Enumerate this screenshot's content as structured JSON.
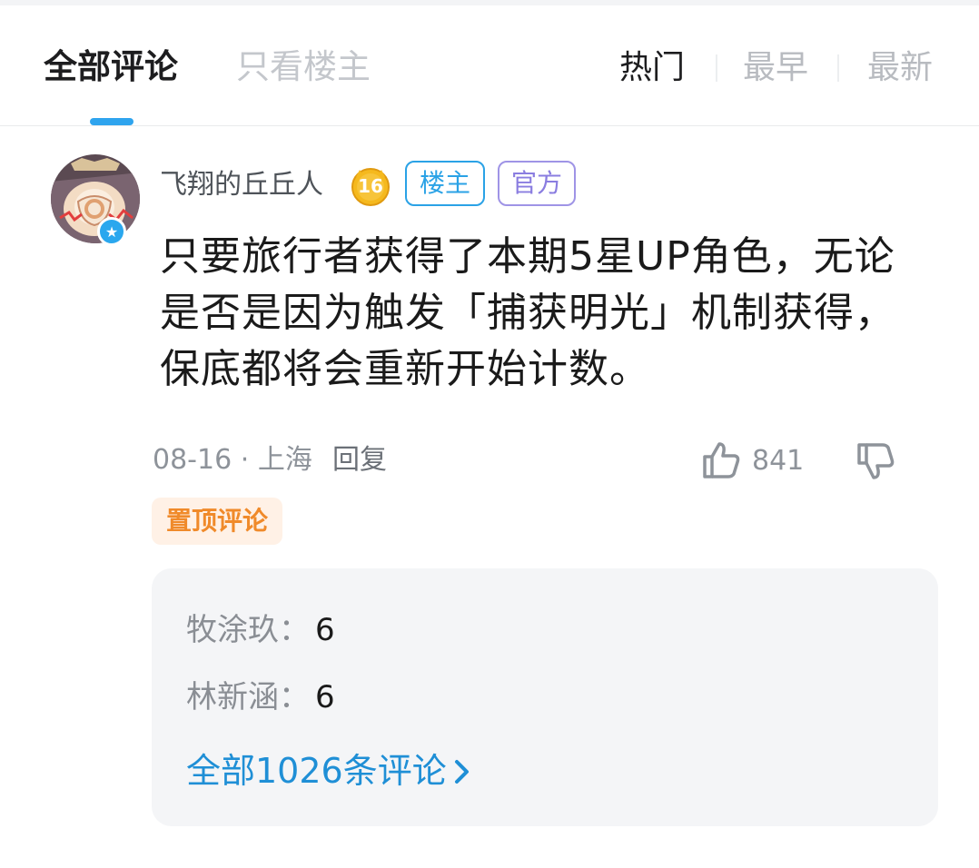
{
  "tabs": {
    "all": "全部评论",
    "op_only": "只看楼主"
  },
  "sort": {
    "hot": "热门",
    "earliest": "最早",
    "latest": "最新"
  },
  "comment": {
    "username": "飞翔的丘丘人",
    "level": "16",
    "tag_op": "楼主",
    "tag_official": "官方",
    "text": "只要旅行者获得了本期5星UP角色，无论是否是因为触发「捕获明光」机制获得，保底都将会重新开始计数。",
    "date": "08-16",
    "separator": "·",
    "location": "上海",
    "reply_label": "回复",
    "like_count": "841",
    "pinned_label": "置顶评论"
  },
  "replies": [
    {
      "name": "牧涂玖：",
      "text": "6"
    },
    {
      "name": "林新涵：",
      "text": "6"
    }
  ],
  "all_replies_link": "全部1026条评论",
  "colors": {
    "accent": "#2fa4ee",
    "op_tag": "#2aa2e6",
    "official_tag": "#8a7de0",
    "pinned": "#f08a2a",
    "link": "#1f8fd6"
  },
  "icons": [
    "verified-badge-icon",
    "level-badge-icon",
    "thumbs-up-icon",
    "thumbs-down-icon",
    "chevron-right-icon"
  ]
}
